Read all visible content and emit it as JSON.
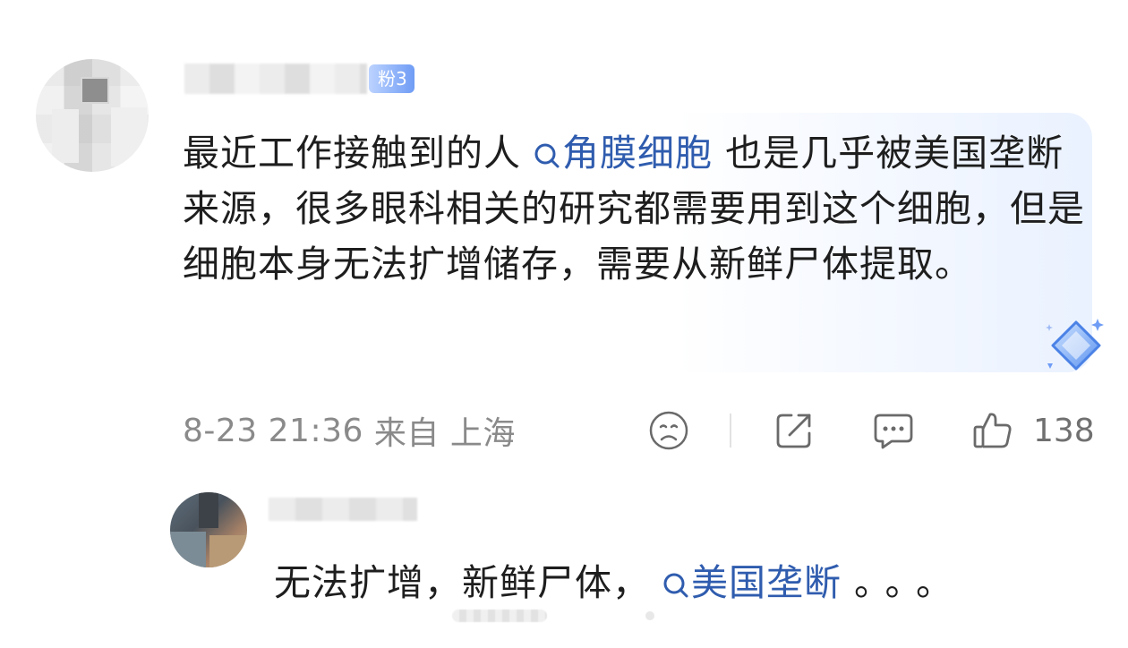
{
  "comment": {
    "author_name": "",
    "fan_badge": "粉3",
    "text_before_topic": "最近工作接触到的人",
    "topic": "角膜细胞",
    "text_after_topic": " 也是几乎被美国垄断来源，很多眼科相关的研究都需要用到这个细胞，但是细胞本身无法扩增储存，需要从新鲜尸体提取。",
    "date": "8-23 21:36",
    "location": "来自 上海",
    "like_count": "138",
    "icons": {
      "badge": "diamond-badge-icon",
      "reaction": "sad-face-icon",
      "share": "share-icon",
      "reply": "comment-icon",
      "like": "thumbs-up-icon"
    }
  },
  "reply": {
    "author_name": "",
    "text_before_topic": "无法扩增，新鲜尸体，",
    "topic": "美国垄断",
    "text_after_topic": "。。。"
  },
  "colors": {
    "topic_link": "#2f5cae",
    "meta_text": "#8a8a8a",
    "fan_badge": "#6f9cf5"
  }
}
